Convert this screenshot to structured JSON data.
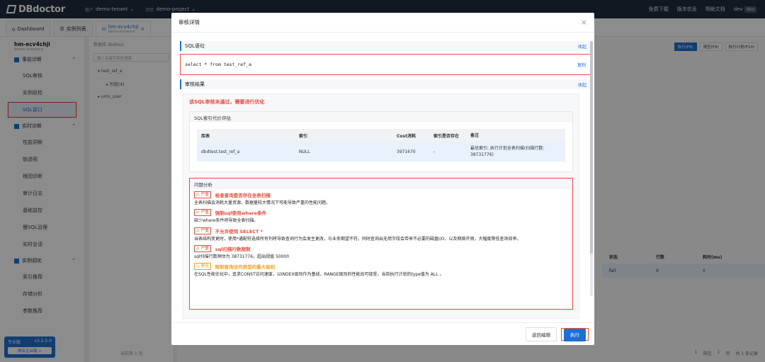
{
  "topbar": {
    "brand": "DBdoctor",
    "tenant_label": "租户",
    "tenant_value": "demo-tenant",
    "project_label": "项目",
    "project_value": "demo-project",
    "links": [
      "免费下载",
      "版本信息",
      "帮助文档"
    ],
    "user": "dev",
    "user_badge": "dev"
  },
  "tabs": [
    {
      "label": "Dashboard",
      "sub": ""
    },
    {
      "label": "实例列表",
      "sub": ""
    },
    {
      "label": "hm-ecv4chji",
      "sub": "demo-instance"
    }
  ],
  "sidebar": {
    "instance_name": "hm-ecv4chji",
    "instance_sub": "demo-instance",
    "groups": [
      {
        "label": "事前诊断",
        "items": [
          "SQL审核",
          "实例巡检",
          "SQL窗口"
        ]
      },
      {
        "label": "实时诊断",
        "items": [
          "性能洞察",
          "锁透视",
          "根因诊断",
          "审计日志",
          "基础监控",
          "慢SQL治理",
          "实时会话"
        ]
      },
      {
        "label": "实例调优",
        "items": [
          "索引推荐",
          "存储分析",
          "参数推荐"
        ]
      }
    ],
    "edition": "专业版",
    "version": "v3.2.5.0",
    "buy": "购买企业版 >"
  },
  "tree": {
    "db_label": "数据库",
    "db_value": "dbdtest",
    "search_placeholder": "输入关键字回车搜索",
    "nodes": [
      "test_ref_a",
      "列组(4)",
      "ums_user"
    ],
    "footer": "当前第 1 页"
  },
  "background": {
    "toolbar": [
      "执行(F8)",
      "清空(F9)",
      "执行计划(F10)"
    ],
    "columns": [
      "状态",
      "行数",
      "耗时(ms)"
    ],
    "row": [
      "fail",
      "0",
      "0"
    ],
    "pager": [
      "1",
      "前往",
      "1",
      "页",
      "共 1 条记录"
    ]
  },
  "modal": {
    "title": "审核详情",
    "close": "×",
    "sql_section": "SQL语句",
    "collapse": "收起",
    "sql_text": "select * from test_ref_a",
    "copy": "复制",
    "result_section": "审核结果",
    "warning": "该SQL审核未通过，需要进行优化",
    "index_eval_title": "SQL索引代价评估",
    "index_table": {
      "headers": [
        "库表",
        "索引",
        "Cost消耗",
        "索引是否存在",
        "备注"
      ],
      "row": [
        "dbdtest.test_ref_a",
        "NULL",
        "3971670",
        "-",
        "最优索引; 执行计划全表扫描(扫描行数: 38731776)"
      ]
    },
    "problem_title": "问题分析",
    "problems": [
      {
        "level": "严重",
        "title": "检查查询是否存在全表扫描",
        "desc": "全表扫描会消耗大量资源，数据量较大情况下可能导致严重的性能问题。"
      },
      {
        "level": "严重",
        "title": "强制sql使用where条件",
        "desc": "缺少where条件将导致全表扫描。"
      },
      {
        "level": "严重",
        "title": "不允许使用 SELECT *",
        "desc": "当表结构变更时，使用*通配符选择所有列将导致查询行为会发生更改，与业务期望不符，同时查询出无用字段会带来不必要的磁盘I/O，以及网络开销，大幅度降低查询效率。"
      },
      {
        "level": "严重",
        "title": "sql扫描行数限制",
        "desc": "sql扫描行数预估为 38731776，超出阈值 50000"
      },
      {
        "level": "警告",
        "title": "限制查询访问类型的最大级别",
        "desc": "在SQL性能优化中，追求CONST访问速度，以INDEX级别作为基线，RANGE级别的性能尚可接受，当前执行计划的type值为 ALL 。"
      }
    ],
    "back_button": "返回编辑",
    "exec_button": "执行"
  }
}
